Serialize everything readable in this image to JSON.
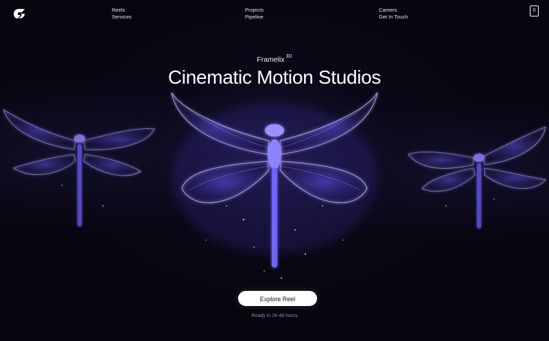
{
  "nav": {
    "col1": [
      "Reels",
      "Services"
    ],
    "col2": [
      "Projects",
      "Pipeline"
    ],
    "col3": [
      "Careers",
      "Get In Touch"
    ]
  },
  "cart_count": "0",
  "hero": {
    "brand": "Framelix",
    "brand_sup": "3D",
    "headline": "Cinematic Motion Studios",
    "cta_label": "Explore Reel",
    "note": "Ready in 24-48 hours"
  },
  "icons": [
    "logo-icon",
    "cart-icon"
  ],
  "colors": {
    "background": "#07060f",
    "glow": "#7a6cff",
    "button": "#ffffff"
  }
}
